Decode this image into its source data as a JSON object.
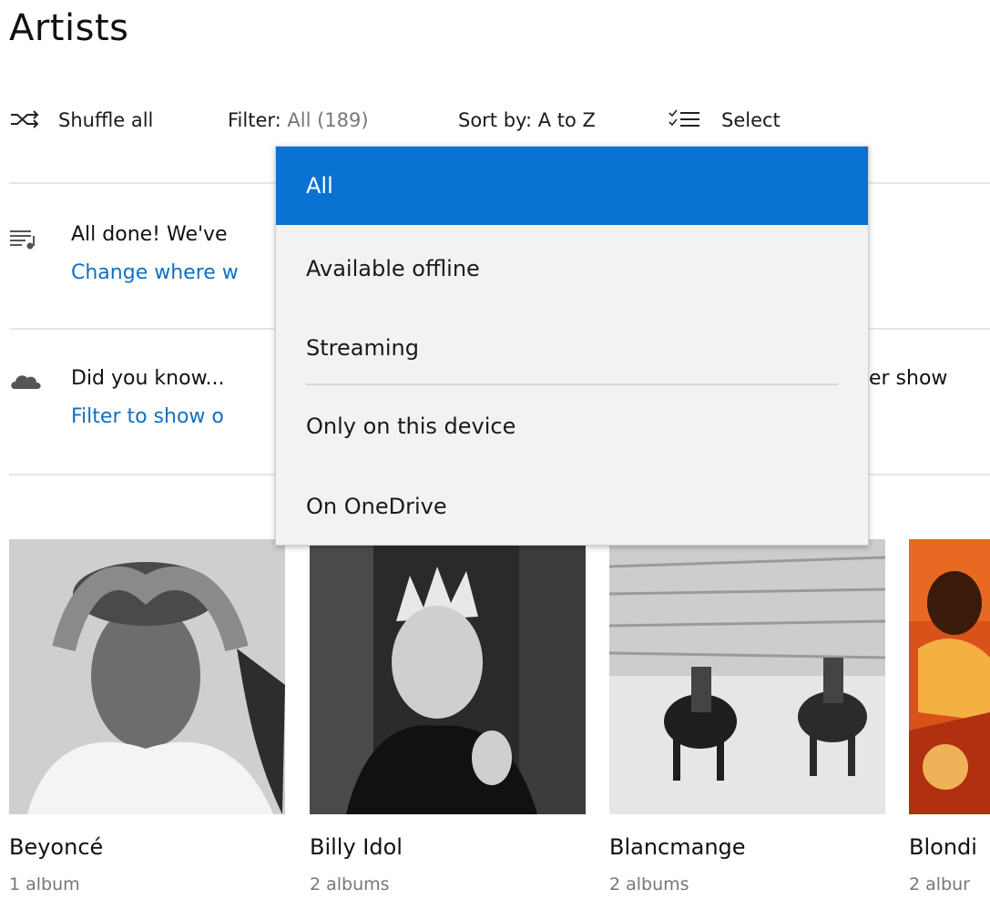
{
  "page": {
    "title": "Artists"
  },
  "toolbar": {
    "shuffle_label": "Shuffle all",
    "filter_label": "Filter:",
    "filter_value": "All (189)",
    "sort_label": "Sort by:",
    "sort_value": "A to Z",
    "select_label": "Select"
  },
  "notices": [
    {
      "icon": "playlist-music-icon",
      "title": "All done! We've",
      "link": "Change where w"
    },
    {
      "icon": "cloud-icon",
      "title": "Did you know...",
      "title_right": "der show",
      "link": "Filter to show o"
    }
  ],
  "filter_dropdown": {
    "selected": "All",
    "items": [
      "All",
      "Available offline",
      "Streaming",
      "Only on this device",
      "On OneDrive"
    ]
  },
  "artists": [
    {
      "name": "Beyoncé",
      "albums": "1 album"
    },
    {
      "name": "Billy Idol",
      "albums": "2 albums"
    },
    {
      "name": "Blancmange",
      "albums": "2 albums"
    },
    {
      "name": "Blondi",
      "albums": "2 albur"
    }
  ],
  "colors": {
    "accent": "#0a72d2",
    "link": "#1070c0"
  }
}
